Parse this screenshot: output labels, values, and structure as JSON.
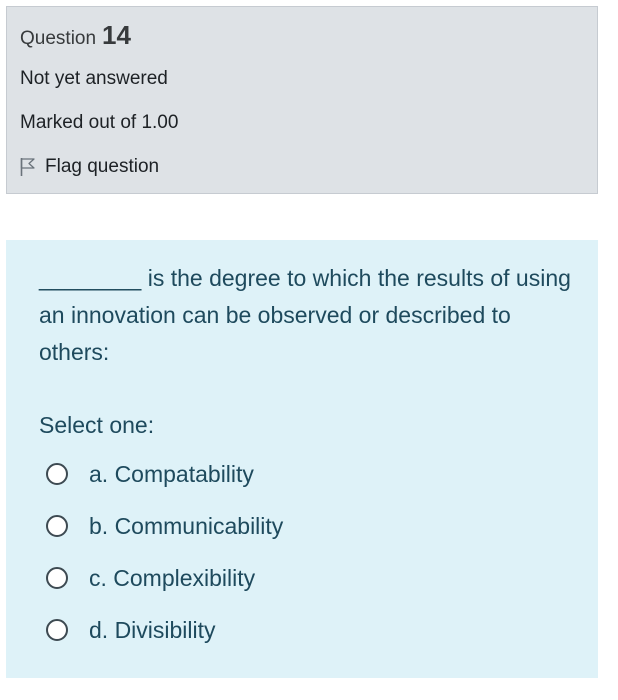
{
  "info": {
    "question_label": "Question",
    "question_number": "14",
    "state": "Not yet answered",
    "grade": "Marked out of 1.00",
    "flag_label": "Flag question"
  },
  "question": {
    "text": "________ is the degree to which the results of using an innovation can be observed or described to others:",
    "prompt": "Select one:",
    "answers": [
      {
        "label": "a. Compatability"
      },
      {
        "label": "b. Communicability"
      },
      {
        "label": "c. Complexibility"
      },
      {
        "label": "d. Divisibility"
      }
    ]
  },
  "colors": {
    "info_background": "#dee2e6",
    "content_background": "#def2f8",
    "question_text": "#1e4a5d"
  },
  "icons": {
    "flag": "flag-outline-icon"
  }
}
